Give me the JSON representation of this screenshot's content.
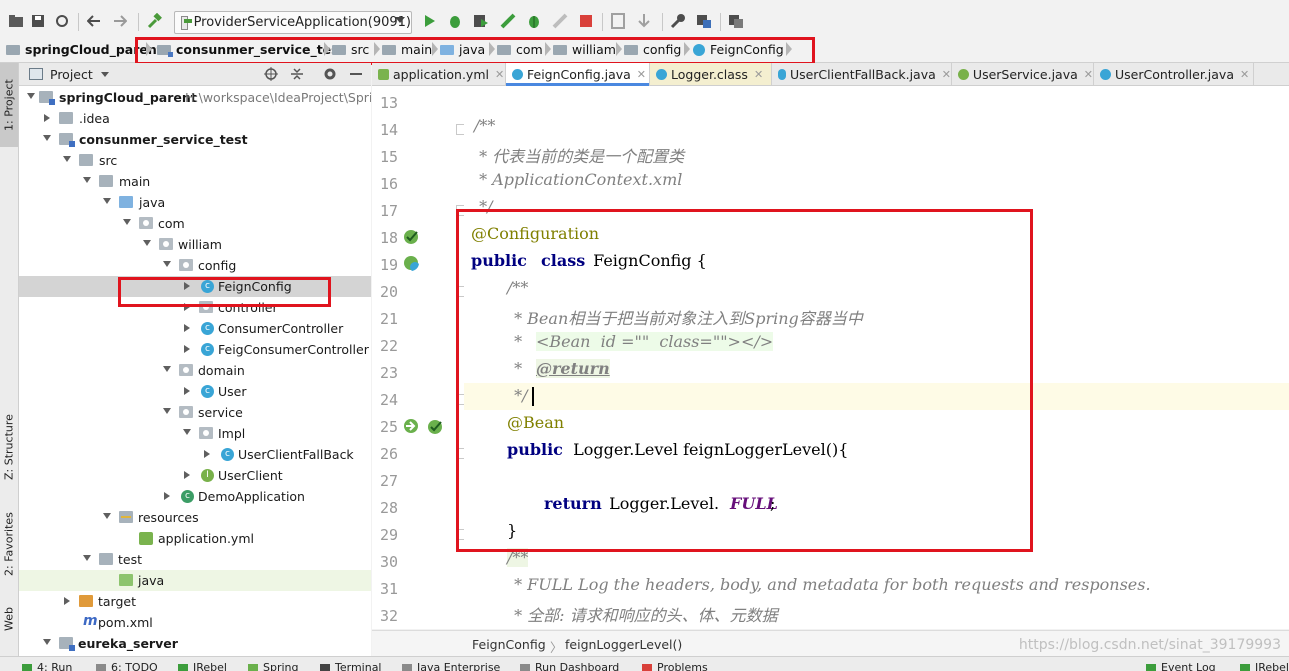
{
  "toolbar": {
    "run_config_label": "ProviderServiceApplication(9091)"
  },
  "breadcrumb": [
    {
      "label": "springCloud_parent"
    },
    {
      "label": "consunmer_service_test"
    },
    {
      "label": "src"
    },
    {
      "label": "main"
    },
    {
      "label": "java"
    },
    {
      "label": "com"
    },
    {
      "label": "william"
    },
    {
      "label": "config"
    },
    {
      "label": "FeignConfig"
    }
  ],
  "left_tabs": {
    "project": "1: Project",
    "structure": "Z: Structure",
    "favorites": "2: Favorites",
    "web": "Web"
  },
  "project_panel": {
    "title": "Project",
    "tree": [
      {
        "label": "springCloud_parent",
        "path": "H:\\workspace\\IdeaProject\\Spring"
      },
      {
        "label": ".idea"
      },
      {
        "label": "consunmer_service_test"
      },
      {
        "label": "src"
      },
      {
        "label": "main"
      },
      {
        "label": "java"
      },
      {
        "label": "com"
      },
      {
        "label": "william"
      },
      {
        "label": "config"
      },
      {
        "label": "FeignConfig"
      },
      {
        "label": "controller"
      },
      {
        "label": "ConsumerController"
      },
      {
        "label": "FeigConsumerController"
      },
      {
        "label": "domain"
      },
      {
        "label": "User"
      },
      {
        "label": "service"
      },
      {
        "label": "Impl"
      },
      {
        "label": "UserClientFallBack"
      },
      {
        "label": "UserClient"
      },
      {
        "label": "DemoApplication"
      },
      {
        "label": "resources"
      },
      {
        "label": "application.yml"
      },
      {
        "label": "test"
      },
      {
        "label": "java"
      },
      {
        "label": "target"
      },
      {
        "label": "pom.xml"
      },
      {
        "label": "eureka_server"
      }
    ]
  },
  "editor_tabs": [
    {
      "label": "application.yml"
    },
    {
      "label": "FeignConfig.java"
    },
    {
      "label": "Logger.class"
    },
    {
      "label": "UserClientFallBack.java"
    },
    {
      "label": "UserService.java"
    },
    {
      "label": "UserController.java"
    }
  ],
  "line_numbers": [
    "13",
    "14",
    "15",
    "16",
    "17",
    "18",
    "19",
    "20",
    "21",
    "22",
    "23",
    "24",
    "25",
    "26",
    "27",
    "28",
    "29",
    "30",
    "31",
    "32"
  ],
  "code": {
    "l14": "/**",
    "l15": " * 代表当前的类是一个配置类",
    "l16": " * ApplicationContext.xml",
    "l17": " */",
    "l18": "@Configuration",
    "l19_kw1": "public",
    "l19_kw2": "class",
    "l19_rest": " FeignConfig {",
    "l20": "/**",
    "l21": " * Bean相当于把当前对象注入到Spring容器当中",
    "l22_prefix": " * ",
    "l22_html": "<Bean  id =\"\"  class=\"\"></>",
    "l23_prefix": " * ",
    "l23_tag": "@return",
    "l24": " */",
    "l25": "@Bean",
    "l26_kw": "public",
    "l26_rest": " Logger.Level feignLoggerLevel(){",
    "l28_kw": "return",
    "l28_mid": " Logger.Level.",
    "l28_const": "FULL",
    "l28_end": ";",
    "l29": "}",
    "l30": "/**",
    "l31": " * FULL Log the headers, body, and metadata for both requests and responses.",
    "l32": " * 全部: 请求和响应的头、体、元数据"
  },
  "editor_breadcrumb": {
    "cls": "FeignConfig",
    "method": "feignLoggerLevel()",
    "watermark": "https://blog.csdn.net/sinat_39179993"
  },
  "bottom_bar": [
    "4: Run",
    "6: TODO",
    "JRebel",
    "Spring",
    "Terminal",
    "Java Enterprise",
    "Run Dashboard",
    "Problems",
    "Event Log",
    "JRebel"
  ],
  "colors": {
    "annotation_box": "#e0141e",
    "keyword": "#000080",
    "comment": "#808080",
    "annotation": "#808000"
  }
}
